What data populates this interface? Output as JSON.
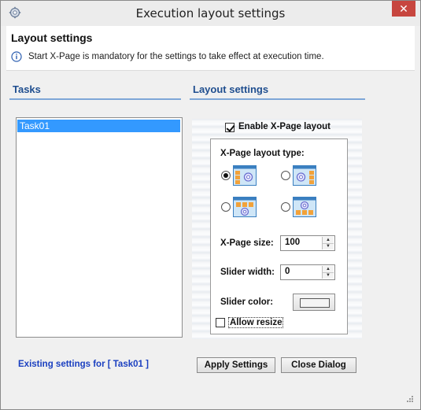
{
  "window": {
    "title": "Execution layout settings",
    "close_symbol": "✕"
  },
  "header": {
    "title": "Layout settings",
    "info_text": "Start X-Page is mandatory for the settings to take effect at execution time."
  },
  "tasks_section": {
    "label": "Tasks",
    "items": [
      "Task01"
    ],
    "selected": "Task01"
  },
  "layout_section": {
    "label": "Layout settings",
    "enable_label": "Enable X-Page layout",
    "enable_checked": true,
    "layout_type_label": "X-Page layout type:",
    "layout_options": [
      {
        "icon": "layout-sidebar-left-icon",
        "selected": true
      },
      {
        "icon": "layout-sidebar-right-icon",
        "selected": false
      },
      {
        "icon": "layout-top-icon",
        "selected": false
      },
      {
        "icon": "layout-bottom-icon",
        "selected": false
      }
    ],
    "page_size_label": "X-Page size:",
    "page_size_value": "100",
    "slider_width_label": "Slider width:",
    "slider_width_value": "0",
    "slider_color_label": "Slider color:",
    "slider_color": "#f4f4f4",
    "allow_resize_label": "Allow resize",
    "allow_resize_checked": false
  },
  "footer": {
    "existing_settings": "Existing settings for [ Task01 ]",
    "apply_label": "Apply Settings",
    "close_label": "Close Dialog"
  },
  "colors": {
    "accent": "#1f4e8f",
    "selection": "#3399ff",
    "link": "#1a3fc0",
    "close": "#c7463f"
  }
}
